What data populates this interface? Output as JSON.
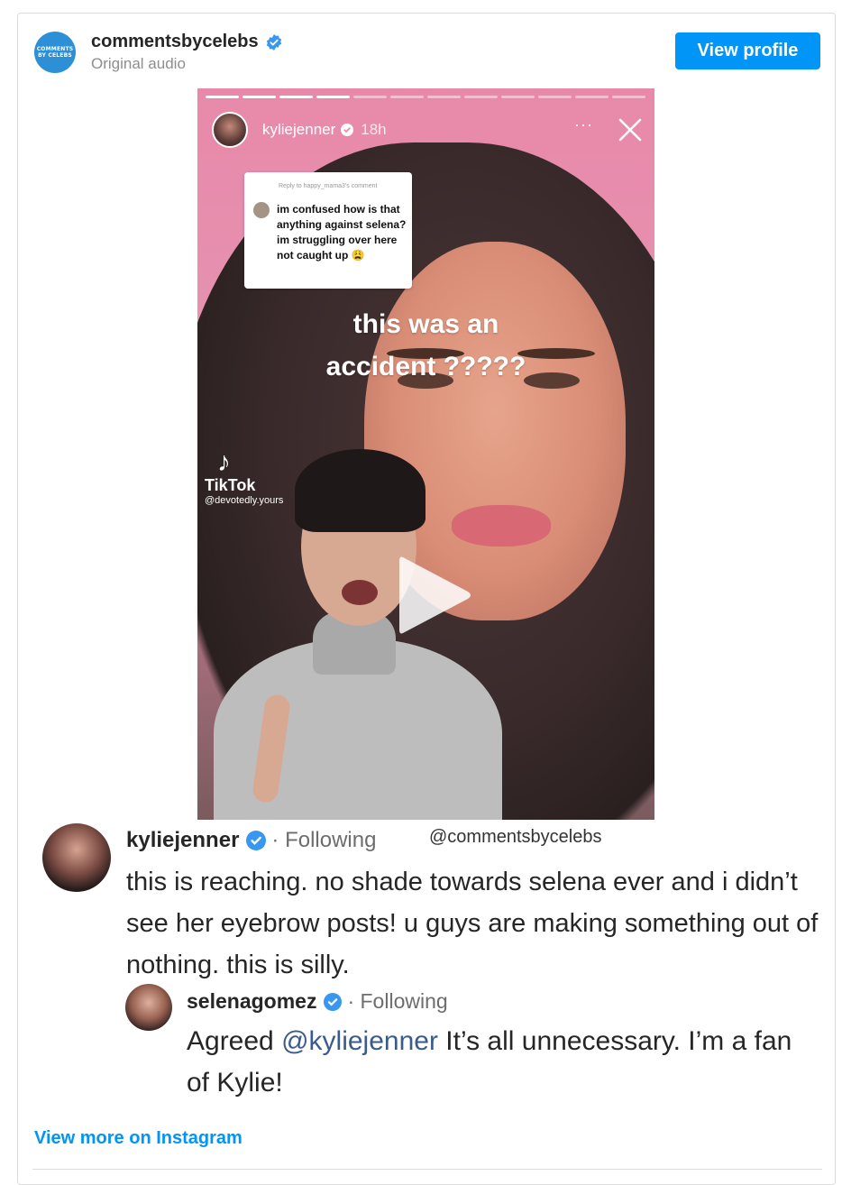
{
  "header": {
    "account": "commentsbycelebs",
    "subtitle": "Original audio",
    "avatar_text_line1": "COMMENTS",
    "avatar_text_line2": "BY CELEBS",
    "view_profile": "View profile"
  },
  "story": {
    "username": "kyliejenner",
    "time": "18h",
    "more": "···",
    "reply_meta": "Reply to happy_mama3's comment",
    "reply_text": "im confused how is that anything against selena? im struggling over here not caught up 😩",
    "caption_line1": "this was an",
    "caption_line2": "accident ?????",
    "tiktok_name": "TikTok",
    "tiktok_handle": "@devotedly.yours"
  },
  "comments": {
    "first": {
      "username": "kyliejenner",
      "following": "· Following",
      "watermark": "@commentsbycelebs",
      "text": "this is reaching. no shade towards selena ever and i didn’t see her eyebrow posts! u guys are making something out of nothing. this is silly."
    },
    "second": {
      "username": "selenagomez",
      "following": "· Following",
      "text_before": "Agreed ",
      "mention": "@kyliejenner",
      "text_after": " It’s all unnecessary. I’m a fan of Kylie!"
    }
  },
  "footer": {
    "view_more": "View more on Instagram"
  },
  "colors": {
    "accent": "#0095f6",
    "verified": "#3897f0"
  }
}
